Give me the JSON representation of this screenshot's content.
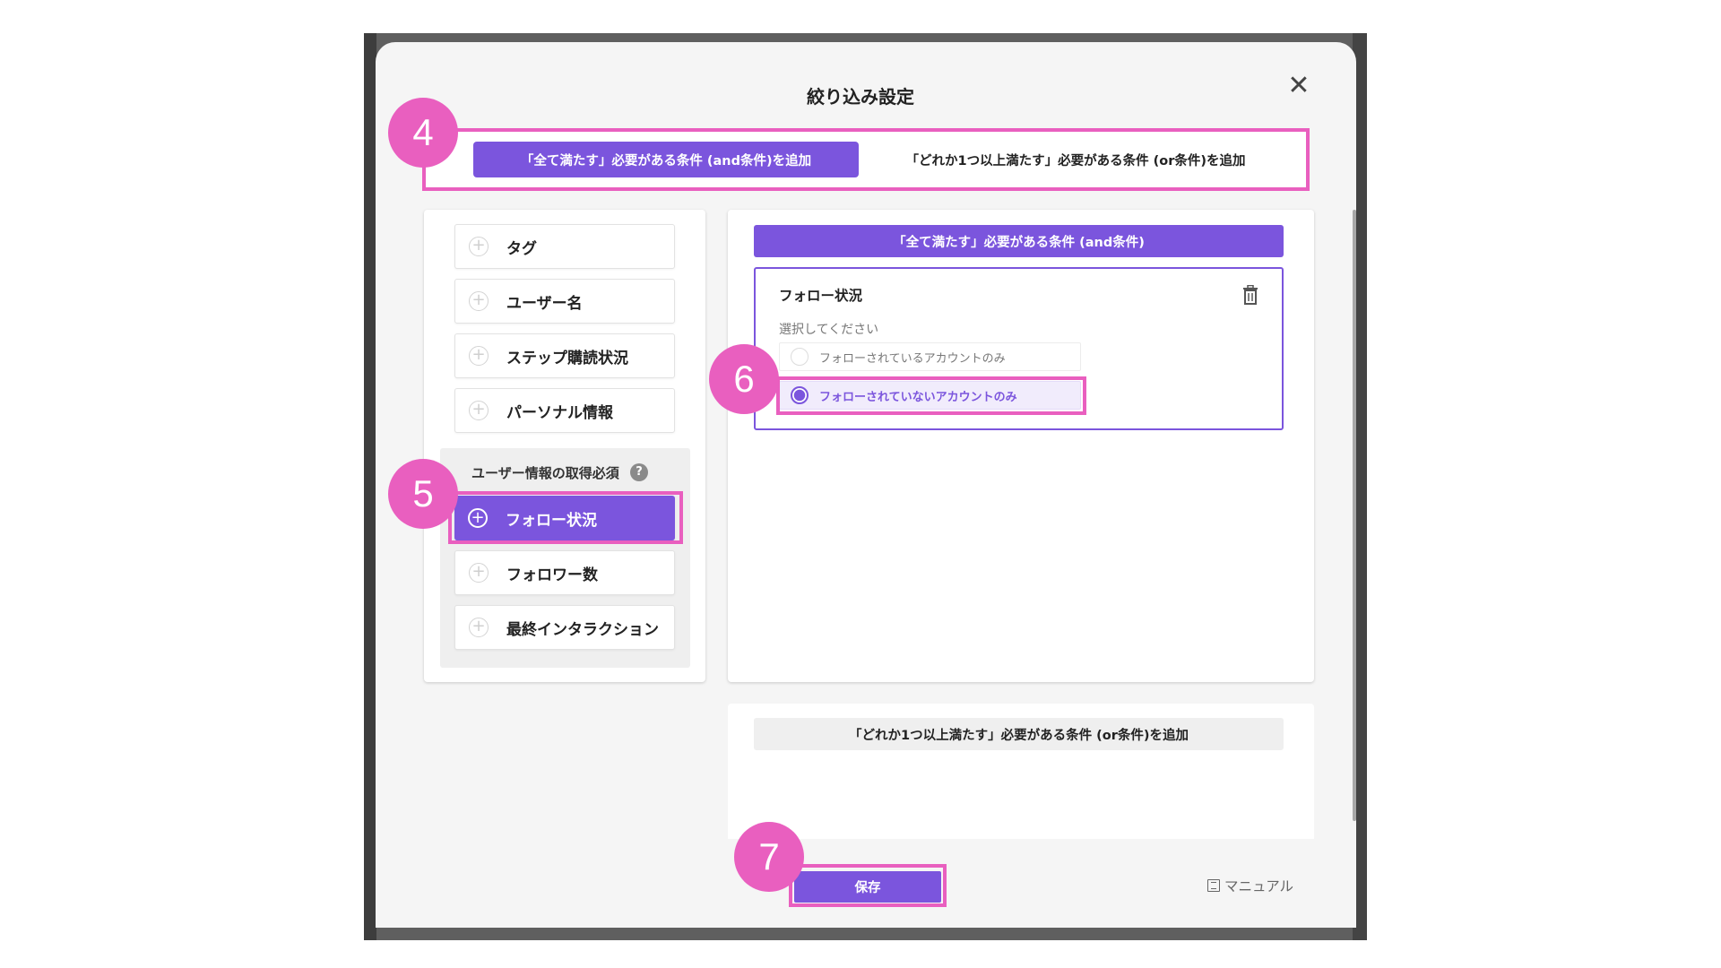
{
  "modal": {
    "title": "絞り込み設定",
    "close_symbol": "✕"
  },
  "tabs": {
    "and_tab": "「全て満たす」必要がある条件 (and条件)を追加",
    "or_tab": "「どれか1つ以上満たす」必要がある条件 (or条件)を追加",
    "active": "and_tab"
  },
  "condition_list": {
    "items": [
      {
        "label": "タグ"
      },
      {
        "label": "ユーザー名"
      },
      {
        "label": "ステップ購読状況"
      },
      {
        "label": "パーソナル情報"
      }
    ],
    "group": {
      "title": "ユーザー情報の取得必須",
      "help_symbol": "?",
      "items": [
        {
          "label": "フォロー状況",
          "active": true
        },
        {
          "label": "フォロワー数"
        },
        {
          "label": "最終インタラクション"
        }
      ]
    }
  },
  "and_section": {
    "header": "「全て満たす」必要がある条件 (and条件)",
    "card": {
      "title": "フォロー状況",
      "select_label": "選択してください",
      "options": [
        {
          "label": "フォローされているアカウントのみ",
          "selected": false
        },
        {
          "label": "フォローされていないアカウントのみ",
          "selected": true
        }
      ]
    }
  },
  "or_section": {
    "header": "「どれか1つ以上満たす」必要がある条件 (or条件)を追加"
  },
  "footer": {
    "save_label": "保存",
    "manual_label": "マニュアル"
  },
  "step_markers": [
    "4",
    "5",
    "6",
    "7"
  ],
  "colors": {
    "accent": "#7b55dd",
    "highlight": "#e95fbf"
  }
}
